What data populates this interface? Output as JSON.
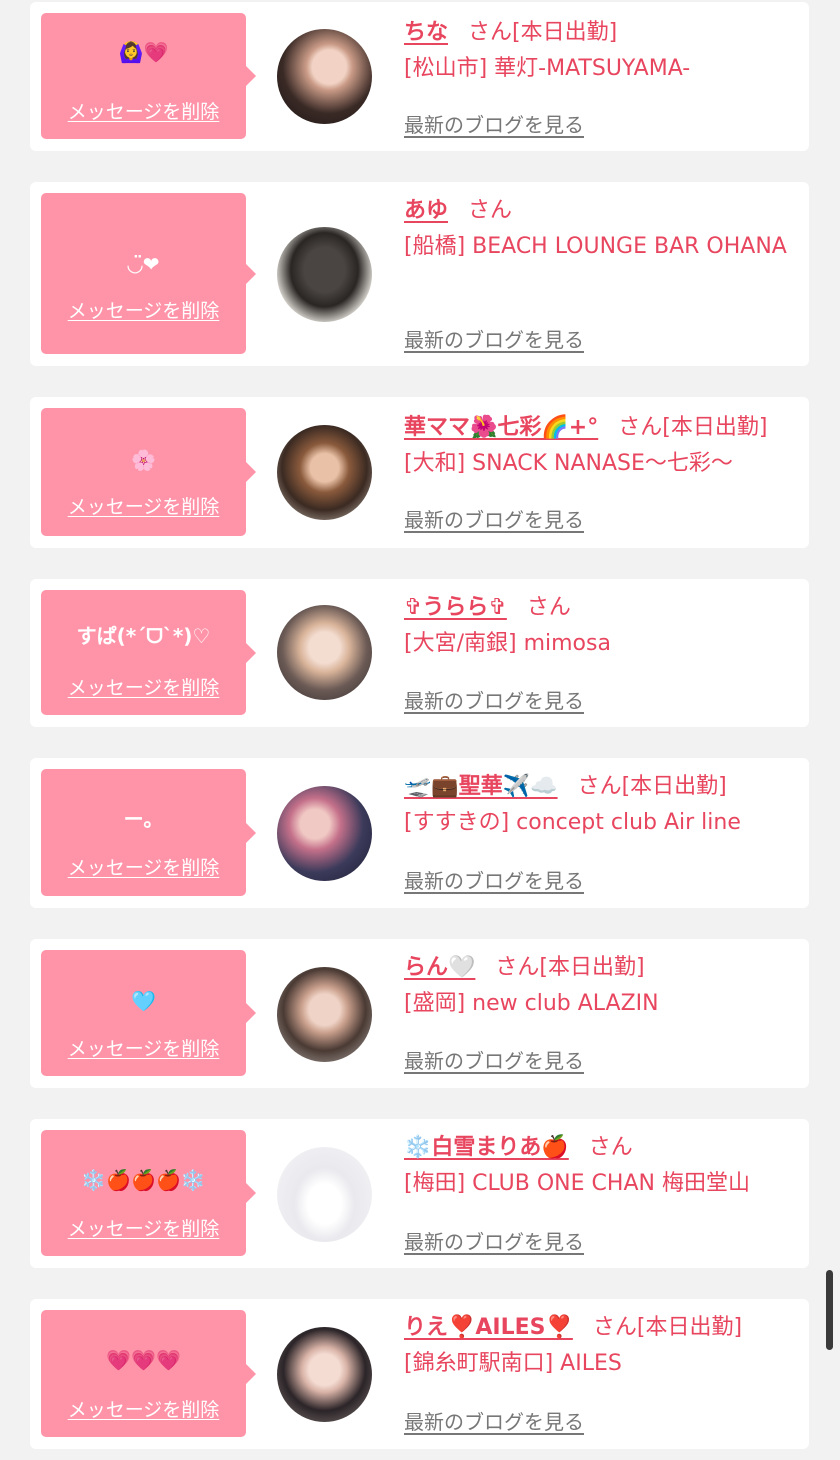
{
  "colors": {
    "accent": "#e8465f",
    "message_bg": "#ff94a9",
    "card_bg": "#ffffff",
    "page_bg": "#f2f2f2"
  },
  "suffix": "さん",
  "blog_label": "最新のブログを見る",
  "delete_label": "メッセージを削除",
  "cards": [
    {
      "message": "🙆‍♀️💗",
      "name": "ちな",
      "status": "[本日出勤]",
      "shop": "[松山市] 華灯-MATSUYAMA-"
    },
    {
      "message": "◡̈❤︎",
      "name": "あゆ",
      "status": "",
      "shop": "[船橋] BEACH LOUNGE BAR OHANA"
    },
    {
      "message": "🌸",
      "name": "華ママ🌺七彩🌈+°",
      "status": "[本日出勤]",
      "shop": "[大和] SNACK NANASE〜七彩〜"
    },
    {
      "message": "すぱ(*ˊᗜˋ*)♡",
      "name": "✞うらら✞",
      "status": "",
      "shop": "[大宮/南銀] mimosa"
    },
    {
      "message": "ー。",
      "name": "🛫💼聖華✈️☁️",
      "status": "[本日出勤]",
      "shop": "[すすきの] concept club Air line"
    },
    {
      "message": "🩵",
      "name": "らん🤍",
      "status": "[本日出勤]",
      "shop": "[盛岡] new club ALAZIN"
    },
    {
      "message": "❄️🍎🍎🍎❄️",
      "name": "❄️白雪まりあ🍎",
      "status": "",
      "shop": "[梅田] CLUB ONE CHAN 梅田堂山"
    },
    {
      "message": "💗💗💗",
      "name": "りえ❣️AILES❣️",
      "status": "[本日出勤]",
      "shop": "[錦糸町駅南口] AILES"
    }
  ]
}
